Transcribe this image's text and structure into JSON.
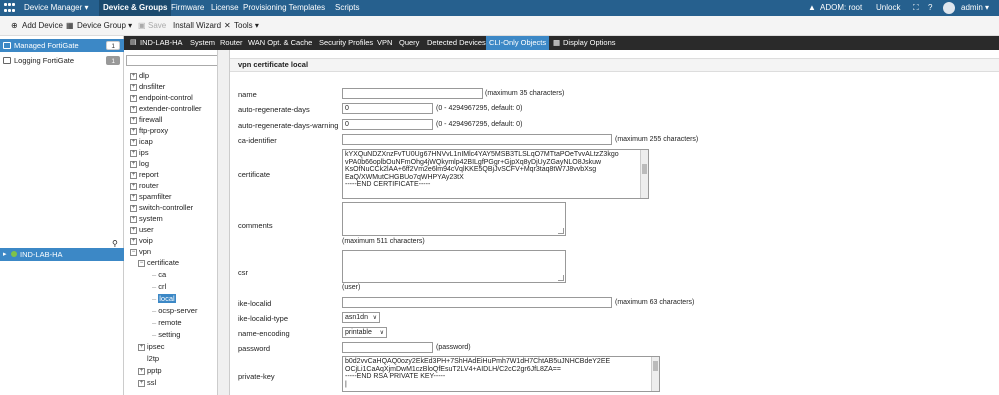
{
  "topbar": {
    "menus": [
      "Device Manager ▾",
      "Device & Groups",
      "Firmware",
      "License",
      "Provisioning Templates",
      "Scripts"
    ],
    "adom": "ADOM: root",
    "unlock": "Unlock",
    "user": "admin ▾"
  },
  "toolbar": {
    "add_device": "Add Device",
    "device_group": "Device Group ▾",
    "save": "Save",
    "install_wizard": "Install Wizard",
    "tools": "Tools ▾"
  },
  "left": {
    "items": [
      {
        "label": "Managed FortiGate",
        "count": "1"
      },
      {
        "label": "Logging FortiGate",
        "count": "1"
      }
    ],
    "device": "IND-LAB-HA"
  },
  "tabs": {
    "device": "IND-LAB-HA",
    "items": [
      "System",
      "Router",
      "WAN Opt. & Cache",
      "Security Profiles",
      "VPN",
      "Query",
      "Detected Devices",
      "CLI-Only Objects",
      "Display Options"
    ]
  },
  "tree": {
    "top": [
      "dlp",
      "dnsfilter",
      "endpoint-control",
      "extender-controller",
      "firewall",
      "ftp-proxy",
      "icap",
      "ips",
      "log",
      "report",
      "router",
      "spamfilter",
      "switch-controller",
      "system",
      "user",
      "voip",
      "vpn"
    ],
    "certificate": "certificate",
    "cert_children": [
      "ca",
      "crl",
      "local",
      "ocsp-server",
      "remote",
      "setting"
    ],
    "bottom": [
      "ipsec",
      "l2tp",
      "pptp",
      "ssl"
    ]
  },
  "form": {
    "title": "vpn certificate local",
    "name": {
      "label": "name",
      "value": "",
      "hint": "(maximum 35 characters)"
    },
    "auto_regen_days": {
      "label": "auto-regenerate-days",
      "value": "0",
      "hint": "(0 - 4294967295, default: 0)"
    },
    "auto_regen_warn": {
      "label": "auto-regenerate-days-warning",
      "value": "0",
      "hint": "(0 - 4294967295, default: 0)"
    },
    "ca_identifier": {
      "label": "ca-identifier",
      "value": "",
      "hint": "(maximum 255 characters)"
    },
    "certificate": {
      "label": "certificate",
      "text": "kYXQuNDZXnzFvTU0Ug67HNVvL1nIMlc4YAY5MSB3TLSLqO7MTtaPOeTvvALtzZ3kgo\nvPA0b66oplbOuNFmOhg4jWQkymlp42BILgfPGgr+GjpXq8yDjUyZGayNLO8Jskuw\nKsOfNuCCk2lAA+6ff2Vm2e6lm94cVqlKKE5QBjJvSCFV+Mqr3taq8tW7J8vvbXsg\nEaQ/XWMutCHGBUo7qWHPYAy23tX\n-----END CERTIFICATE-----"
    },
    "comments": {
      "label": "comments",
      "hint": "(maximum 511 characters)"
    },
    "csr": {
      "label": "csr",
      "hint": "(user)"
    },
    "ike_localid": {
      "label": "ike-localid",
      "value": "",
      "hint": "(maximum 63 characters)"
    },
    "ike_localid_type": {
      "label": "ike-localid-type",
      "value": "asn1dn"
    },
    "name_encoding": {
      "label": "name-encoding",
      "value": "printable"
    },
    "password": {
      "label": "password",
      "value": "",
      "hint": "(password)"
    },
    "private_key": {
      "label": "private-key",
      "text": "b0d2vvCaHQAQ0ozy2EkEd3PH+7ShHAdEiHuPmh7W1dH7ChtAB5uJNHCBdeY2EE\nOCjLi1CaAqXjmDwM1czBloQfEsuT2LV4+AIDLH/C2cC2gr6JfL8ZA==\n-----END RSA PRIVATE KEY-----\n|"
    }
  }
}
